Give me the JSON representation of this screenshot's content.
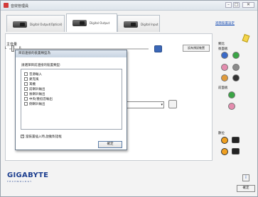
{
  "window": {
    "title": "音效管理員",
    "minimize": "–",
    "maximize": "□",
    "close": "✕"
  },
  "tabs": [
    {
      "label": "Digital Output(Optical)"
    },
    {
      "label": "Digital Output"
    },
    {
      "label": "Digital Input"
    }
  ],
  "advanced_link": "進階裝置設定",
  "main_volume": {
    "label": "主音量",
    "left": "L",
    "right": "R",
    "set_default_label": "設為預設裝置"
  },
  "dialog": {
    "title": "目前連接的裝置類型為",
    "prompt": "請選擇目前連接的裝置類型:",
    "items": [
      {
        "label": "音源輸入"
      },
      {
        "label": "麥克風"
      },
      {
        "label": "耳機"
      },
      {
        "label": "前喇叭輸出"
      },
      {
        "label": "後喇叭輸出"
      },
      {
        "label": "中央/重低音輸出"
      },
      {
        "label": "側喇叭輸出"
      }
    ],
    "autopop_label": "當裝置插入時,啟動對話框",
    "ok_label": "確定"
  },
  "right_panel": {
    "analog_label": "類比",
    "back_panel_label": "後面板",
    "front_panel_label": "前面板",
    "digital_label": "數位"
  },
  "colors": {
    "green": "#3aa545",
    "blue": "#3a6ac8",
    "pink": "#e48cae",
    "gray": "#8a8a8a",
    "brand_blue": "#1d3f8f"
  },
  "brand": {
    "name": "GIGABYTE",
    "tagline": "TECHNOLOGY"
  },
  "footer": {
    "close_label": "確定",
    "info_icon": "i"
  }
}
